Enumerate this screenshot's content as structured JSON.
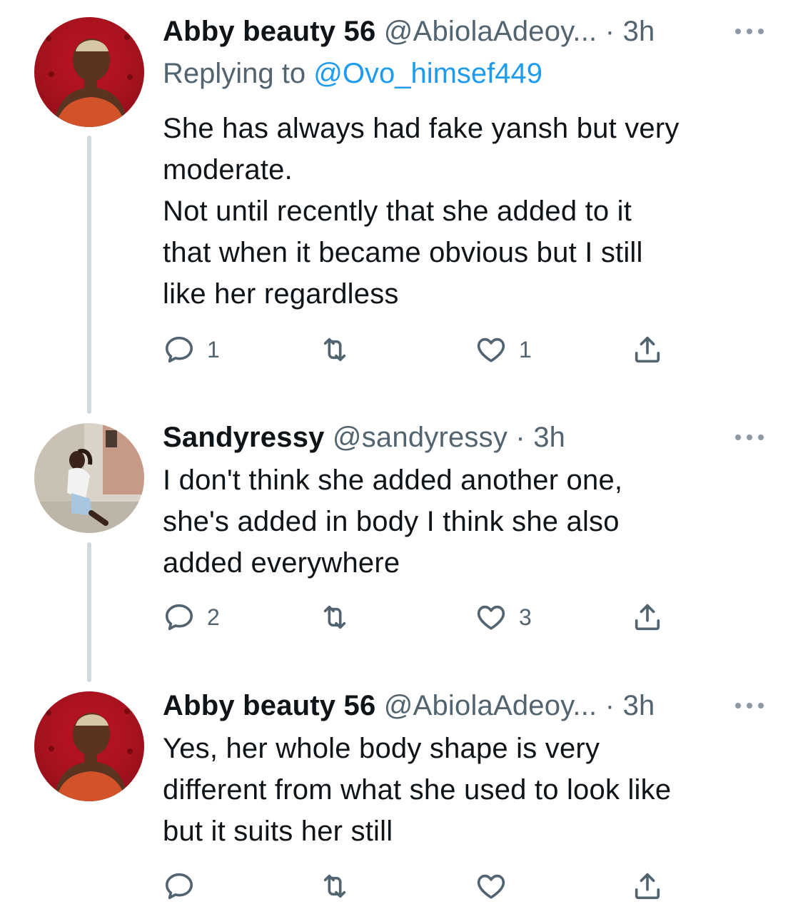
{
  "tweets": [
    {
      "name": "Abby beauty 56",
      "handle": "@AbiolaAdeoy...",
      "dot": "·",
      "time": "3h",
      "reply_prefix": "Replying to ",
      "reply_mention": "@Ovo_himsef449",
      "text": "She has always had fake yansh but very\nmoderate.\nNot until recently that she added to it\nthat when it became obvious but I still\nlike her regardless",
      "replies": "1",
      "retweets": "",
      "likes": "1"
    },
    {
      "name": "Sandyressy",
      "handle": "@sandyressy",
      "dot": "·",
      "time": "3h",
      "text": "I don't think she added another one,\nshe's added in body I think she also\nadded everywhere",
      "replies": "2",
      "retweets": "",
      "likes": "3"
    },
    {
      "name": "Abby beauty 56",
      "handle": "@AbiolaAdeoy...",
      "dot": "·",
      "time": "3h",
      "text": "Yes, her whole body shape is very\ndifferent from what she used to look like\nbut it suits her still",
      "replies": "",
      "retweets": "",
      "likes": ""
    }
  ],
  "icons": {
    "reply": "reply-icon",
    "retweet": "retweet-icon",
    "like": "heart-icon",
    "share": "share-icon",
    "more": "more-icon"
  },
  "colors": {
    "text": "#0f1419",
    "secondary": "#536471",
    "link": "#1d9bf0",
    "thread_line": "#cfd9de"
  }
}
